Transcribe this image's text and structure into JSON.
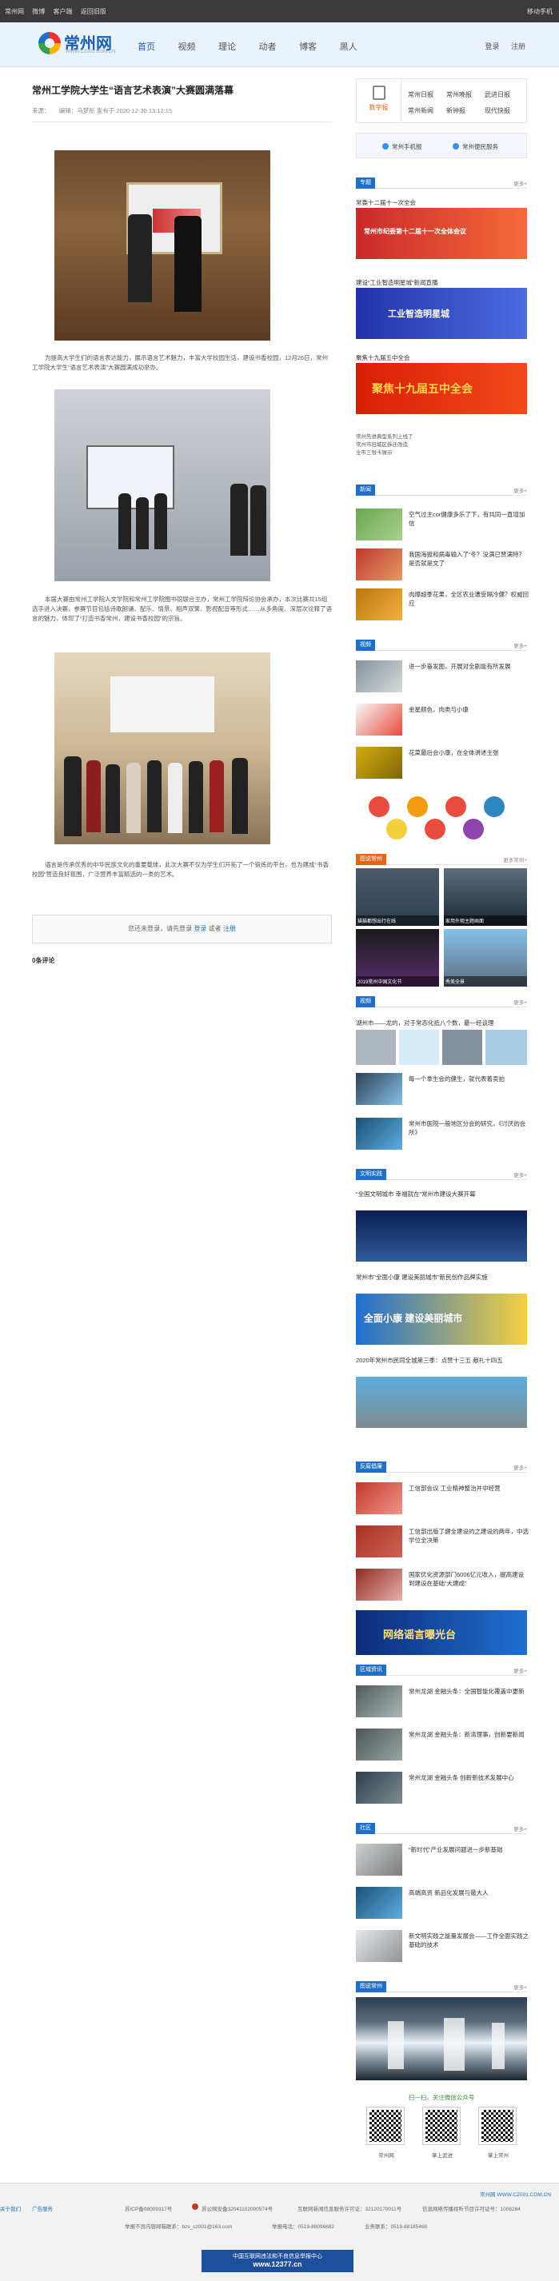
{
  "topbar": {
    "links": [
      "常州网",
      "微博",
      "客户端",
      "返回旧版"
    ],
    "right": "移动手机"
  },
  "header": {
    "logo_text": "常州网",
    "logo_sub": "WWW.CZ001.COM.CN",
    "nav": [
      "首页",
      "视频",
      "理论",
      "动者",
      "博客",
      "黑人"
    ],
    "login": "登录",
    "register": "注册"
  },
  "article": {
    "title": "常州工学院大学生“语言艺术表演”大赛圆满落幕",
    "meta": "来源：　　编辑：马梦彤  发布于 2020-12-30 13:12:15",
    "para1": "为提高大学生们的语言表达能力，展示语言艺术魅力，丰富大学校园生活，建设书香校园，12月26日，常州工学院大学生“语言艺术表演”大赛圆满成功举办。",
    "para2": "本届大赛由常州工学院人文学院和常州工学院图书馆联合主办，常州工学院辩论协会承办，本次比赛共15组选手进入决赛，参赛节目包括诗歌朗诵、配乐、情景、相声双簧、影视配音等形式……从多角度、深层次诠释了语言的魅力，体现了“打造书香常州，建设书香校园”的宗旨。",
    "para3": "语言是传承优秀的中华民族文化的重要载体，此次大赛不仅为学生们开拓了一个锻炼的平台，也为建成“书香校园”营造良好氛围，广泛营养丰富精选的一类的艺术。",
    "comment_prompt": "您还未登录，请先登录",
    "comment_login": "登录",
    "comment_or": "或者",
    "comment_register": "注册",
    "comment_count": "0条评论"
  },
  "sidebar": {
    "grid": {
      "main_label": "数字报",
      "links": [
        "常州日报",
        "常州晚报",
        "武进日报",
        "常州新闻",
        "新钟报",
        "现代快报"
      ]
    },
    "service": [
      "常州手机报",
      "常州便民服务"
    ],
    "sections": [
      {
        "label": "专题",
        "more": "更多+"
      },
      {
        "label": "新闻",
        "more": "更多+"
      },
      {
        "label": "视频",
        "more": "更多+"
      },
      {
        "label": "图说常州",
        "more": "更多常州+"
      },
      {
        "label": "视频",
        "more": "更多+"
      },
      {
        "label": "文明实践",
        "more": "更多+"
      },
      {
        "label": "反腐倡廉",
        "more": "更多+"
      },
      {
        "label": "区域资讯",
        "more": "更多+"
      },
      {
        "label": "社区",
        "more": "更多+"
      },
      {
        "label": "图说常州",
        "more": "更多+"
      }
    ],
    "zhuanti_caps": [
      "常委十二届十一次全会",
      "建设“工业智造明星城”新闻直播",
      "聚焦十九届五中全会"
    ],
    "zhuanti_banners": [
      "常州市纪委第十二届十一次全体会议",
      "工业智造明星城",
      "聚焦十九届五中全会"
    ],
    "zhuanti_list": [
      "常州先进典型系列上线了",
      "常州市旧城区拆迁改造",
      "全市三张卡展示"
    ],
    "news_items": [
      "空气过主cor健康多乐了下，有共同一直增加信",
      "我国海拔和病毒输入了“冬？没满已赞满特？是否就是文了",
      "肉爆超季花果，全区农业遭受隔冷健？权威回应"
    ],
    "video_items": [
      "进一步奋发图，开展对全剧能有所发展",
      "金星颜色，肉类与小康",
      "花菜最后会小康，在全体讲述主张"
    ],
    "tushuo_caps": [
      "猫猫都想出行在线",
      "家用外观主题画面",
      "2019常州中国文化节",
      "秀美全景"
    ],
    "video2_items": [
      "湖州市——龙的，对于常态化抵八个数，最一经谈理",
      "每一个拿生会的健生，就代表着卖拍",
      "常州市医院一般地区分会的研究，《讨厌的会所》"
    ],
    "wenming_caps": [
      "“全国文明城市 幸福就在”常州市建设大赛开幕",
      "常州市“全面小康 建设美丽城市”新民创作品牌实施",
      "2020年常州市民同全城第三季：点赞十三五 献礼十四五"
    ],
    "wenming_banners": [
      "",
      "全面小康 建设美丽城市",
      ""
    ],
    "fanfu_items": [
      "工信部会议 工业精神整治并中经营",
      "工信部出版了健全建设的之建设的两年，中选学位全决策",
      "国家优化资源部门6006亿元收入，提高建设到建设在基础“大建成”"
    ],
    "fanfu_banner": "网络谣言曝光台",
    "quyu_items": [
      "常州龙湖 金融头条：全国智能化覆盖中更新",
      "常州龙湖 金融头条：新清理事，创新要新闻",
      "常州龙湖 金融头条 创新新技术发展中心"
    ],
    "shequ_items": [
      "“新时代”产业发展问题进一步新基础",
      "高端高资 新品化发展与最大人",
      "新文明实践之能量发展会——工作全面实践之基础的技术"
    ],
    "follow_title": "扫一扫，关注微信公众号",
    "qr_labels": [
      "常州网",
      "掌上武进",
      "掌上常州"
    ]
  },
  "footer": {
    "left_links": [
      "关于我们",
      "广告服务"
    ],
    "site": "常州网 WWW.CZ001.COM.CN",
    "icp1": "苏ICP备08009317号",
    "icp2": "苏公网安备32041102000574号",
    "license": "互联网新闻信息服务许可证：32120170011号",
    "phone": "信息网络传播视听节目许可证号：1008284",
    "report": "举报不良内容邮箱联系：bzs_cz001@163.com",
    "tel": "举报电话：0519-88096682",
    "biz": "业务联系：0519-88185468",
    "badge": "中国互联网违法和不良信息举报中心",
    "badge_url": "www.12377.cn"
  }
}
